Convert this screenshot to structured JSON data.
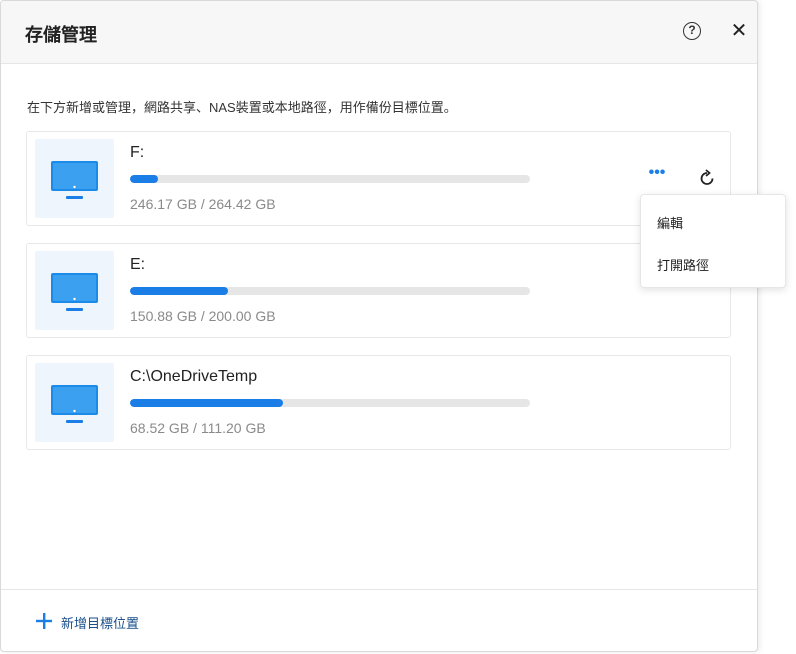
{
  "dialog": {
    "title": "存儲管理",
    "help_icon": "question-circle-icon",
    "close_icon": "close-icon",
    "description": "在下方新增或管理，網路共享、NAS裝置或本地路徑，用作備份目標位置。"
  },
  "drives": [
    {
      "name": "F:",
      "size_text": "246.17 GB / 264.42 GB",
      "usage_fraction": 0.07
    },
    {
      "name": "E:",
      "size_text": "150.88 GB / 200.00 GB",
      "usage_fraction": 0.245
    },
    {
      "name": "C:\\OneDriveTemp",
      "size_text": "68.52 GB / 111.20 GB",
      "usage_fraction": 0.383
    }
  ],
  "context_menu": {
    "items": [
      {
        "label": "編輯"
      },
      {
        "label": "打開路徑"
      }
    ]
  },
  "footer": {
    "add_label": "新增目標位置",
    "add_icon": "plus-icon"
  },
  "colors": {
    "accent": "#1a7ee6",
    "bar_track": "#e6e6e6",
    "icon_bg": "#eef5fc"
  }
}
